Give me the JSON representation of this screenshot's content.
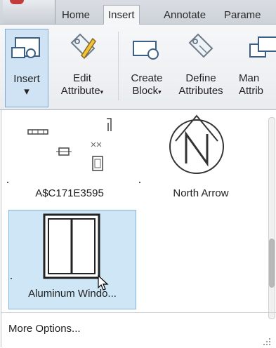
{
  "tabs": [
    {
      "label": "Home"
    },
    {
      "label": "Insert"
    },
    {
      "label": "Annotate"
    },
    {
      "label": "Parame"
    }
  ],
  "ribbon": {
    "insert": {
      "line1": "Insert",
      "line2": "▾"
    },
    "edit_attribute": {
      "line1": "Edit",
      "line2": "Attribute"
    },
    "create_block": {
      "line1": "Create",
      "line2": "Block"
    },
    "define_attributes": {
      "line1": "Define",
      "line2": "Attributes"
    },
    "manage_attributes": {
      "line1": "Man",
      "line2": "Attrib"
    },
    "caret": "▾"
  },
  "gallery": {
    "items": [
      {
        "name": "A$C171E3595"
      },
      {
        "name": "North Arrow"
      },
      {
        "name": "Aluminum Windo..."
      }
    ],
    "more_options": "More Options..."
  },
  "colors": {
    "tab_bar": "#cdd2d9",
    "selection": "#cfe6f6",
    "selection_border": "#83b5dd",
    "app_accent": "#c23c3c"
  }
}
